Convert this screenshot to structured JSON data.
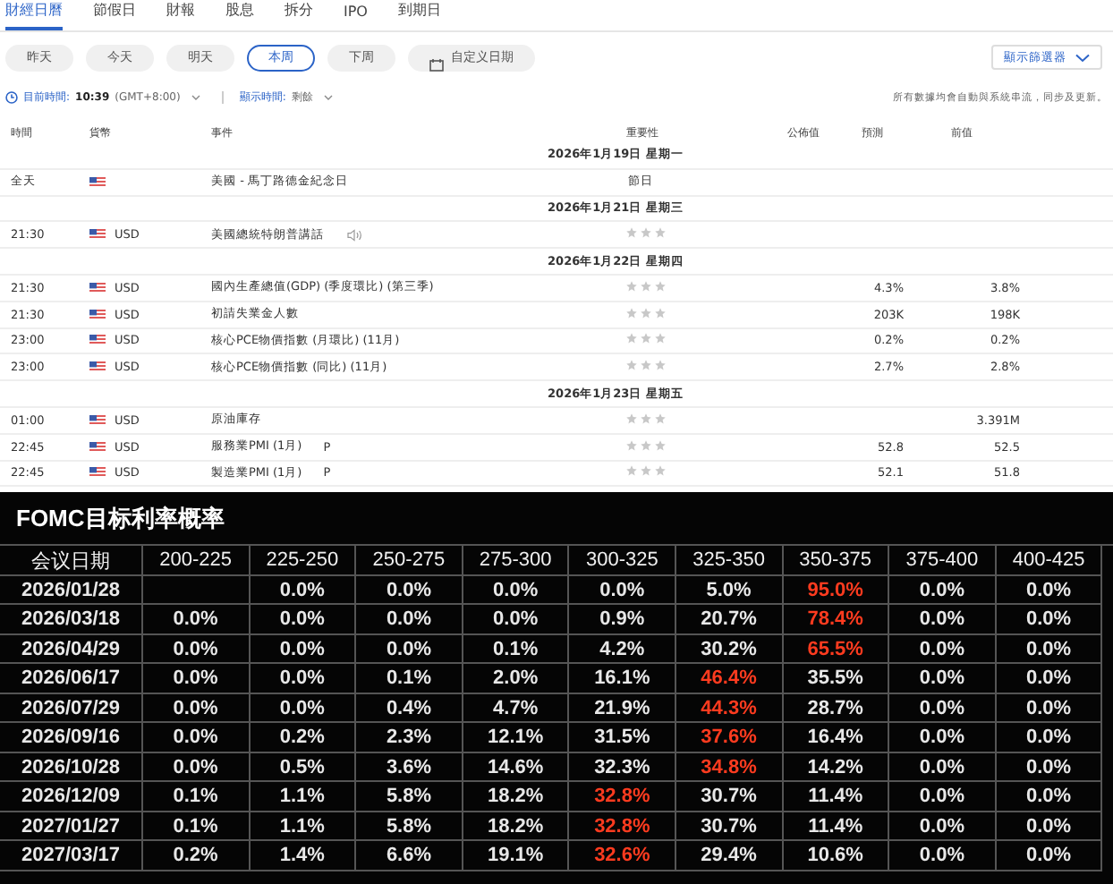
{
  "tabs": [
    {
      "label": "財經日曆",
      "selected": true
    },
    {
      "label": "節假日",
      "selected": false
    },
    {
      "label": "財報",
      "selected": false
    },
    {
      "label": "股息",
      "selected": false
    },
    {
      "label": "拆分",
      "selected": false
    },
    {
      "label": "IPO",
      "selected": false
    },
    {
      "label": "到期日",
      "selected": false
    }
  ],
  "quick_dates": [
    {
      "label": "昨天",
      "selected": false,
      "kind": "preset"
    },
    {
      "label": "今天",
      "selected": false,
      "kind": "preset"
    },
    {
      "label": "明天",
      "selected": false,
      "kind": "preset"
    },
    {
      "label": "本周",
      "selected": true,
      "kind": "preset"
    },
    {
      "label": "下周",
      "selected": false,
      "kind": "preset"
    },
    {
      "label": "自定义日期",
      "selected": false,
      "kind": "custom"
    }
  ],
  "filter_button": {
    "label": "顯示篩選器"
  },
  "time_bar": {
    "current_label": "目前時間:",
    "current_time": "10:39",
    "timezone": "(GMT+8:00)",
    "display_label": "顯示時間:",
    "display_value": "剩餘"
  },
  "sync_note": "所有數據均會自動與系統串流，同步及更新。",
  "calendar": {
    "columns": [
      "時間",
      "貨幣",
      "事件",
      "重要性",
      "公佈值",
      "預測",
      "前值"
    ],
    "days": [
      {
        "date": "2026年1月19日 星期一",
        "events": [
          {
            "time": "全天",
            "event": "美國 - 馬丁路德金紀念日",
            "kind": "holiday",
            "importance": "節日",
            "speech": false
          }
        ]
      },
      {
        "date": "2026年1月21日 星期三",
        "events": [
          {
            "time": "21:30",
            "currency": "USD",
            "event": "美國總統特朗普講話",
            "kind": "stars",
            "stars": 0,
            "speech": true
          }
        ]
      },
      {
        "date": "2026年1月22日 星期四",
        "events": [
          {
            "time": "21:30",
            "currency": "USD",
            "event": "國內生產總值(GDP) (季度環比) (第三季)",
            "kind": "stars",
            "stars": 0,
            "speech": false,
            "forecast": "4.3%",
            "previous": "3.8%"
          },
          {
            "time": "21:30",
            "currency": "USD",
            "event": "初請失業金人數",
            "kind": "stars",
            "stars": 0,
            "speech": false,
            "forecast": "203K",
            "previous": "198K"
          },
          {
            "time": "23:00",
            "currency": "USD",
            "event": "核心PCE物價指數 (月環比) (11月)",
            "kind": "stars",
            "stars": 0,
            "speech": false,
            "forecast": "0.2%",
            "previous": "0.2%"
          },
          {
            "time": "23:00",
            "currency": "USD",
            "event": "核心PCE物價指數 (同比) (11月)",
            "kind": "stars",
            "stars": 0,
            "speech": false,
            "forecast": "2.7%",
            "previous": "2.8%"
          }
        ]
      },
      {
        "date": "2026年1月23日 星期五",
        "events": [
          {
            "time": "01:00",
            "currency": "USD",
            "event": "原油庫存",
            "kind": "stars",
            "stars": 0,
            "speech": false,
            "previous": "3.391M"
          },
          {
            "time": "22:45",
            "currency": "USD",
            "event": "服務業PMI (1月)",
            "tag": "P",
            "kind": "stars",
            "stars": 0,
            "speech": false,
            "forecast": "52.8",
            "previous": "52.5"
          },
          {
            "time": "22:45",
            "currency": "USD",
            "event": "製造業PMI (1月)",
            "tag": "P",
            "kind": "stars",
            "stars": 0,
            "speech": false,
            "forecast": "52.1",
            "previous": "51.8"
          }
        ]
      }
    ]
  },
  "fomc": {
    "title": "FOMC目标利率概率",
    "columns": [
      "会议日期",
      "200-225",
      "225-250",
      "250-275",
      "275-300",
      "300-325",
      "325-350",
      "350-375",
      "375-400",
      "400-425"
    ],
    "rows": [
      {
        "cells": [
          {
            "text": "2026/01/28",
            "highlight": false
          },
          {
            "text": ""
          },
          {
            "text": "0.0%",
            "highlight": false
          },
          {
            "text": "0.0%",
            "highlight": false
          },
          {
            "text": "0.0%",
            "highlight": false
          },
          {
            "text": "0.0%",
            "highlight": false
          },
          {
            "text": "5.0%",
            "highlight": false
          },
          {
            "text": "95.0%",
            "highlight": true
          },
          {
            "text": "0.0%",
            "highlight": false
          },
          {
            "text": "0.0%",
            "highlight": false
          }
        ]
      },
      {
        "cells": [
          {
            "text": "2026/03/18",
            "highlight": false
          },
          {
            "text": "0.0%",
            "highlight": false
          },
          {
            "text": "0.0%",
            "highlight": false
          },
          {
            "text": "0.0%",
            "highlight": false
          },
          {
            "text": "0.0%",
            "highlight": false
          },
          {
            "text": "0.9%",
            "highlight": false
          },
          {
            "text": "20.7%",
            "highlight": false
          },
          {
            "text": "78.4%",
            "highlight": true
          },
          {
            "text": "0.0%",
            "highlight": false
          },
          {
            "text": "0.0%",
            "highlight": false
          }
        ]
      },
      {
        "cells": [
          {
            "text": "2026/04/29",
            "highlight": false
          },
          {
            "text": "0.0%",
            "highlight": false
          },
          {
            "text": "0.0%",
            "highlight": false
          },
          {
            "text": "0.0%",
            "highlight": false
          },
          {
            "text": "0.1%",
            "highlight": false
          },
          {
            "text": "4.2%",
            "highlight": false
          },
          {
            "text": "30.2%",
            "highlight": false
          },
          {
            "text": "65.5%",
            "highlight": true
          },
          {
            "text": "0.0%",
            "highlight": false
          },
          {
            "text": "0.0%",
            "highlight": false
          }
        ]
      },
      {
        "cells": [
          {
            "text": "2026/06/17",
            "highlight": false
          },
          {
            "text": "0.0%",
            "highlight": false
          },
          {
            "text": "0.0%",
            "highlight": false
          },
          {
            "text": "0.1%",
            "highlight": false
          },
          {
            "text": "2.0%",
            "highlight": false
          },
          {
            "text": "16.1%",
            "highlight": false
          },
          {
            "text": "46.4%",
            "highlight": true
          },
          {
            "text": "35.5%",
            "highlight": false
          },
          {
            "text": "0.0%",
            "highlight": false
          },
          {
            "text": "0.0%",
            "highlight": false
          }
        ]
      },
      {
        "cells": [
          {
            "text": "2026/07/29",
            "highlight": false
          },
          {
            "text": "0.0%",
            "highlight": false
          },
          {
            "text": "0.0%",
            "highlight": false
          },
          {
            "text": "0.4%",
            "highlight": false
          },
          {
            "text": "4.7%",
            "highlight": false
          },
          {
            "text": "21.9%",
            "highlight": false
          },
          {
            "text": "44.3%",
            "highlight": true
          },
          {
            "text": "28.7%",
            "highlight": false
          },
          {
            "text": "0.0%",
            "highlight": false
          },
          {
            "text": "0.0%",
            "highlight": false
          }
        ]
      },
      {
        "cells": [
          {
            "text": "2026/09/16",
            "highlight": false
          },
          {
            "text": "0.0%",
            "highlight": false
          },
          {
            "text": "0.2%",
            "highlight": false
          },
          {
            "text": "2.3%",
            "highlight": false
          },
          {
            "text": "12.1%",
            "highlight": false
          },
          {
            "text": "31.5%",
            "highlight": false
          },
          {
            "text": "37.6%",
            "highlight": true
          },
          {
            "text": "16.4%",
            "highlight": false
          },
          {
            "text": "0.0%",
            "highlight": false
          },
          {
            "text": "0.0%",
            "highlight": false
          }
        ]
      },
      {
        "cells": [
          {
            "text": "2026/10/28",
            "highlight": false
          },
          {
            "text": "0.0%",
            "highlight": false
          },
          {
            "text": "0.5%",
            "highlight": false
          },
          {
            "text": "3.6%",
            "highlight": false
          },
          {
            "text": "14.6%",
            "highlight": false
          },
          {
            "text": "32.3%",
            "highlight": false
          },
          {
            "text": "34.8%",
            "highlight": true
          },
          {
            "text": "14.2%",
            "highlight": false
          },
          {
            "text": "0.0%",
            "highlight": false
          },
          {
            "text": "0.0%",
            "highlight": false
          }
        ]
      },
      {
        "cells": [
          {
            "text": "2026/12/09",
            "highlight": false
          },
          {
            "text": "0.1%",
            "highlight": false
          },
          {
            "text": "1.1%",
            "highlight": false
          },
          {
            "text": "5.8%",
            "highlight": false
          },
          {
            "text": "18.2%",
            "highlight": false
          },
          {
            "text": "32.8%",
            "highlight": true
          },
          {
            "text": "30.7%",
            "highlight": false
          },
          {
            "text": "11.4%",
            "highlight": false
          },
          {
            "text": "0.0%",
            "highlight": false
          },
          {
            "text": "0.0%",
            "highlight": false
          }
        ]
      },
      {
        "cells": [
          {
            "text": "2027/01/27",
            "highlight": false
          },
          {
            "text": "0.1%",
            "highlight": false
          },
          {
            "text": "1.1%",
            "highlight": false
          },
          {
            "text": "5.8%",
            "highlight": false
          },
          {
            "text": "18.2%",
            "highlight": false
          },
          {
            "text": "32.8%",
            "highlight": true
          },
          {
            "text": "30.7%",
            "highlight": false
          },
          {
            "text": "11.4%",
            "highlight": false
          },
          {
            "text": "0.0%",
            "highlight": false
          },
          {
            "text": "0.0%",
            "highlight": false
          }
        ]
      },
      {
        "cells": [
          {
            "text": "2027/03/17",
            "highlight": false
          },
          {
            "text": "0.2%",
            "highlight": false
          },
          {
            "text": "1.4%",
            "highlight": false
          },
          {
            "text": "6.6%",
            "highlight": false
          },
          {
            "text": "19.1%",
            "highlight": false
          },
          {
            "text": "32.6%",
            "highlight": true
          },
          {
            "text": "29.4%",
            "highlight": false
          },
          {
            "text": "10.6%",
            "highlight": false
          },
          {
            "text": "0.0%",
            "highlight": false
          },
          {
            "text": "0.0%",
            "highlight": false
          }
        ]
      }
    ]
  }
}
